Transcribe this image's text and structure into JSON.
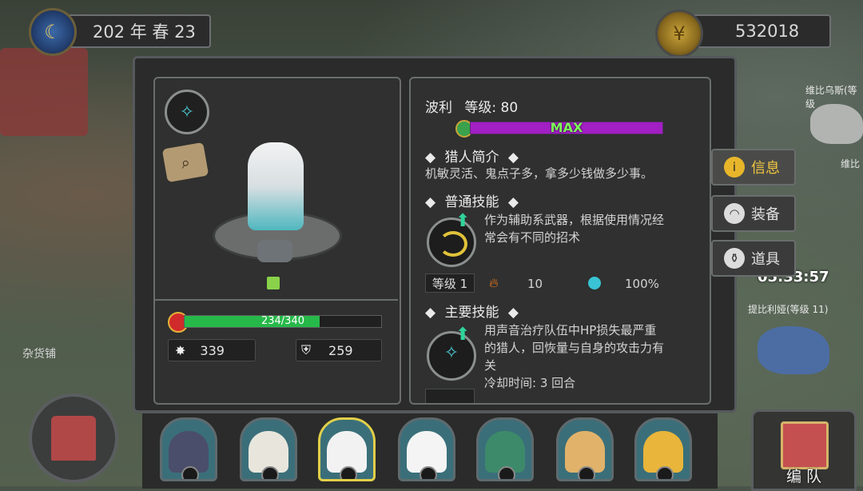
{
  "top": {
    "date": "202 年 春 23",
    "gold": "532018"
  },
  "character": {
    "name": "波利",
    "level_label": "等级: 80",
    "exp_status": "MAX",
    "hp_text": "234/340",
    "hp_fraction": 0.688,
    "attack": "339",
    "defense": "259"
  },
  "intro": {
    "title": "猎人简介",
    "text": "机敏灵活、鬼点子多，拿多少钱做多少事。"
  },
  "normal_skill": {
    "title": "普通技能",
    "desc_line1": "作为辅助系武器，根据使用情况经",
    "desc_line2": "常会有不同的招术",
    "level_label": "等级 1",
    "stat1": "10",
    "stat2": "100%"
  },
  "main_skill": {
    "title": "主要技能",
    "desc_line1": "用声音治疗队伍中HP损失最严重",
    "desc_line2": "的猎人，回恢量与自身的攻击力有",
    "desc_line3": "关",
    "cooldown": "冷却时间: 3 回合"
  },
  "side_menu": {
    "info": "信息",
    "equip": "装备",
    "item": "道具"
  },
  "team_button": "编 队",
  "map_labels": {
    "label1": "维比乌斯(等级",
    "label2": "维比",
    "label3": "提比利娅(等级 11)",
    "timer": "05:33:57",
    "shop": "杂货铺"
  },
  "colors": {
    "exp_bar": "#a21fc4",
    "hp_bar": "#27b84a",
    "selected_border": "#e2cf4a"
  }
}
